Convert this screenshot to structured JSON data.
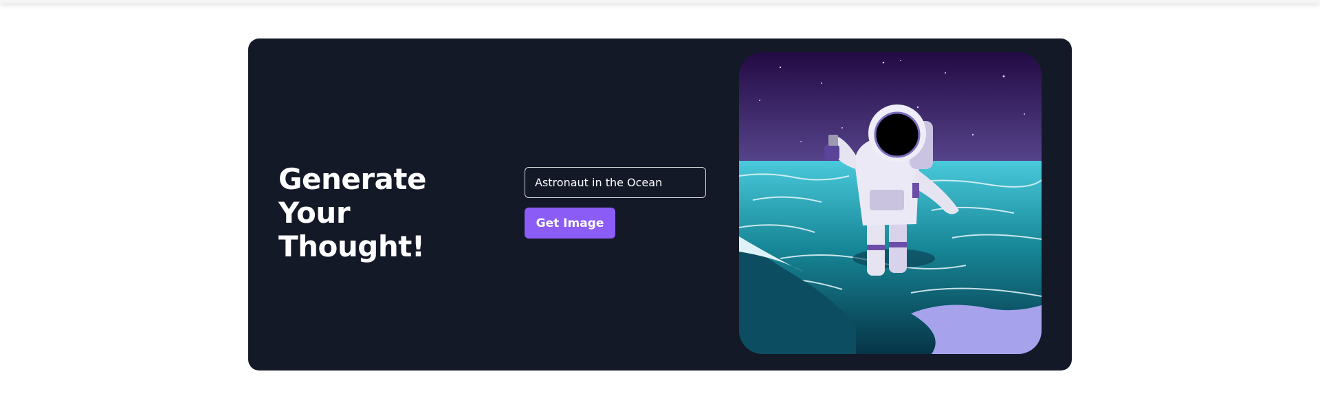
{
  "hero": {
    "title_line1": "Generate Your",
    "title_line2": "Thought!"
  },
  "prompt": {
    "value": "Astronaut in the Ocean",
    "placeholder": ""
  },
  "action": {
    "label": "Get Image"
  },
  "generated_image": {
    "alt": "Astronaut in the Ocean",
    "subject": "astronaut wading in ocean under starry purple sky"
  },
  "colors": {
    "card_background": "#131927",
    "button": "#8b5cf6",
    "text": "#ffffff",
    "input_border": "#d6d6dc"
  }
}
